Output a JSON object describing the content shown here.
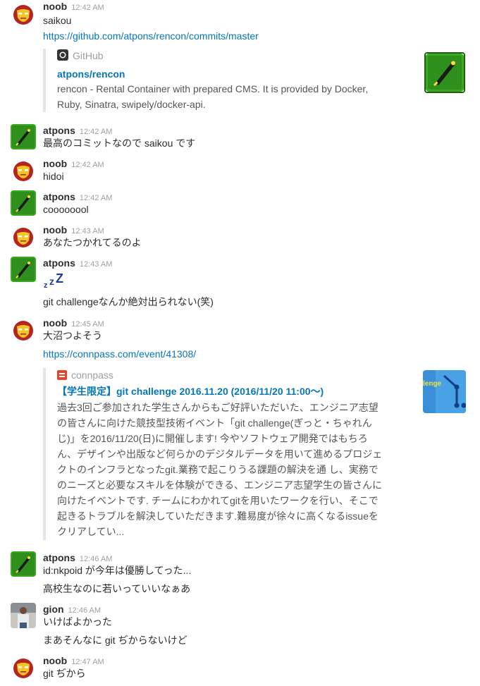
{
  "messages": [
    {
      "user": "noob",
      "time": "12:42 AM",
      "lines": [
        "saikou"
      ],
      "link": "https://github.com/atpons/rencon/commits/master",
      "attachment": {
        "service": "GitHub",
        "title": "atpons/rencon",
        "text": [
          "rencon - Rental Container with prepared CMS. It is provided by Docker,",
          "Ruby, Sinatra, swipely/docker-api."
        ]
      }
    },
    {
      "user": "atpons",
      "time": "12:42 AM",
      "lines": [
        "最高のコミットなので saikou です"
      ]
    },
    {
      "user": "noob",
      "time": "12:42 AM",
      "lines": [
        "hidoi"
      ]
    },
    {
      "user": "atpons",
      "time": "12:42 AM",
      "lines": [
        "coooooool"
      ]
    },
    {
      "user": "noob",
      "time": "12:43 AM",
      "lines": [
        "あなたつかれてるのよ"
      ]
    },
    {
      "user": "atpons",
      "time": "12:43 AM",
      "emoji": "zzz-emoji",
      "lines": [
        "git challengeなんか絶対出られない(笑)"
      ]
    },
    {
      "user": "noob",
      "time": "12:45 AM",
      "lines": [
        "大沼つよそう"
      ],
      "link": "https://connpass.com/event/41308/",
      "attachment": {
        "service": "connpass",
        "title": "【学生限定】git challenge 2016.11.20 (2016/11/20 11:00〜)",
        "text": [
          "過去3回ご参加された学生さんからもご好評いただいた、エンジニア志望",
          "の皆さんに向けた競技型技術イベント「git challenge(ぎっと・ちゃれん",
          "じ)」を2016/11/20(日)に開催します! 今やソフトウェア開発ではもちろ",
          "ん、デザインや出版など何らかのデジタルデータを用いて進めるプロジェ",
          "クトのインフラとなったgit.業務で起こりうる課題の解決を通 し、実務で",
          "のニーズと必要なスキルを体験ができる、エンジニア志望学生の皆さんに",
          "向けたイベントです. チームにわかれてgitを用いたワークを行い、そこで",
          "起きるトラブルを解決していただきます.難易度が徐々に高くなるissueを",
          "クリアしてい..."
        ],
        "thumb_text": "lenge"
      }
    },
    {
      "user": "atpons",
      "time": "12:46 AM",
      "lines": [
        "id:nkpoid が今年は優勝してった...",
        "高校生なのに若いっていいなぁあ"
      ]
    },
    {
      "user": "gion",
      "time": "12:46 AM",
      "lines": [
        "いけばよかった",
        "まあそんなに git ぢからないけど"
      ]
    },
    {
      "user": "noob",
      "time": "12:47 AM",
      "lines": [
        "git ぢから"
      ]
    }
  ],
  "colors": {
    "link": "#0576b9",
    "timestamp": "#9e9ea6",
    "attachment_bar": "#e3e4e6",
    "atpons_avatar": "#4caf2a",
    "noob_avatar": "#c8201c"
  }
}
